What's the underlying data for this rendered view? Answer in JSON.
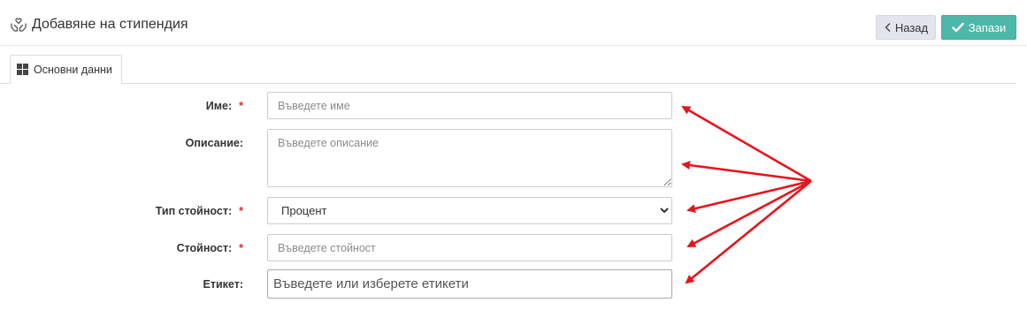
{
  "header": {
    "title": "Добавяне на стипендия",
    "back_label": "Назад",
    "save_label": "Запази"
  },
  "tabs": [
    {
      "label": "Основни данни"
    }
  ],
  "form": {
    "name": {
      "label": "Име:",
      "required_mark": "*",
      "placeholder": "Въведете име"
    },
    "description": {
      "label": "Описание:",
      "placeholder": "Въведете описание"
    },
    "value_type": {
      "label": "Тип стойност:",
      "required_mark": "*",
      "selected": "Процент"
    },
    "value": {
      "label": "Стойност:",
      "required_mark": "*",
      "placeholder": "Въведете стойност"
    },
    "tags": {
      "label": "Етикет:",
      "placeholder": "Въведете или изберете етикети"
    }
  },
  "colors": {
    "save_button": "#4db8a8",
    "back_button": "#e2e6ec",
    "required": "#e0262d",
    "annotation_arrows": "#e8141c"
  },
  "icons": [
    "hands-heart-icon",
    "chevron-left-icon",
    "check-icon",
    "grid-icon",
    "chevron-down-icon"
  ]
}
